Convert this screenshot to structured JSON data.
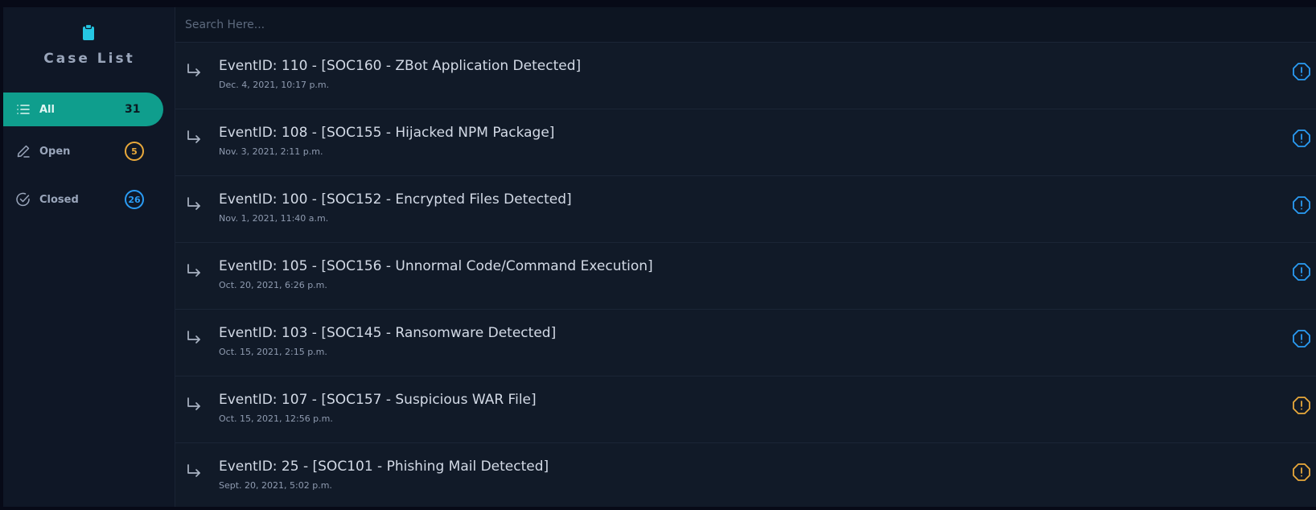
{
  "sidebar": {
    "title": "Case List",
    "icon": "clipboard-icon",
    "items": [
      {
        "label": "All",
        "count": "31",
        "icon": "list-icon",
        "active": true
      },
      {
        "label": "Open",
        "count": "5",
        "icon": "pencil-icon",
        "badge_color": "#e9a93b"
      },
      {
        "label": "Closed",
        "count": "26",
        "icon": "check-circle-icon",
        "badge_color": "#2a9cf4"
      }
    ]
  },
  "search": {
    "placeholder": "Search Here..."
  },
  "cases": [
    {
      "title": "EventID: 110 - [SOC160 - ZBot Application Detected]",
      "date": "Dec. 4, 2021, 10:17 p.m.",
      "status_color": "#2a9cf4",
      "status_icon": "alert-octagon-icon"
    },
    {
      "title": "EventID: 108 - [SOC155 - Hijacked NPM Package]",
      "date": "Nov. 3, 2021, 2:11 p.m.",
      "status_color": "#2a9cf4",
      "status_icon": "alert-octagon-icon"
    },
    {
      "title": "EventID: 100 - [SOC152 - Encrypted Files Detected]",
      "date": "Nov. 1, 2021, 11:40 a.m.",
      "status_color": "#2a9cf4",
      "status_icon": "alert-octagon-icon"
    },
    {
      "title": "EventID: 105 - [SOC156 - Unnormal Code/Command Execution]",
      "date": "Oct. 20, 2021, 6:26 p.m.",
      "status_color": "#2a9cf4",
      "status_icon": "alert-octagon-icon"
    },
    {
      "title": "EventID: 103 - [SOC145 - Ransomware Detected]",
      "date": "Oct. 15, 2021, 2:15 p.m.",
      "status_color": "#2a9cf4",
      "status_icon": "alert-octagon-icon"
    },
    {
      "title": "EventID: 107 - [SOC157 - Suspicious WAR File]",
      "date": "Oct. 15, 2021, 12:56 p.m.",
      "status_color": "#e9a93b",
      "status_icon": "alert-octagon-icon"
    },
    {
      "title": "EventID: 25 - [SOC101 - Phishing Mail Detected]",
      "date": "Sept. 20, 2021, 5:02 p.m.",
      "status_color": "#e9a93b",
      "status_icon": "alert-octagon-icon"
    }
  ],
  "colors": {
    "accent": "#0f9e8d",
    "brand_icon": "#25c7e3"
  }
}
